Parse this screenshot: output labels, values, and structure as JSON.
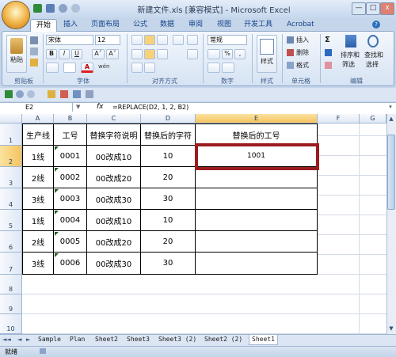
{
  "window": {
    "title": "新建文件.xls [兼容模式] - Microsoft Excel",
    "min": "—",
    "max": "□",
    "close": "x"
  },
  "tabs": [
    "开始",
    "插入",
    "页面布局",
    "公式",
    "数据",
    "审阅",
    "视图",
    "开发工具",
    "Acrobat"
  ],
  "ribbon": {
    "clipboard": {
      "label": "剪贴板",
      "paste": "粘贴"
    },
    "font": {
      "label": "字体",
      "name": "宋体",
      "size": "12",
      "bold": "B",
      "italic": "I",
      "underline": "U",
      "grow": "A˄",
      "shrink": "A˅",
      "font_color": "A",
      "wen": "wén"
    },
    "alignment": {
      "label": "对齐方式"
    },
    "number": {
      "label": "数字",
      "format": "常规",
      "percent": "%",
      "comma": ","
    },
    "styles": {
      "label": "样式",
      "text": "样式"
    },
    "cells": {
      "label": "单元格",
      "insert": "插入",
      "delete": "删除",
      "format": "格式"
    },
    "editing": {
      "label": "编辑",
      "sort": "排序和",
      "sort2": "筛选",
      "find": "查找和",
      "find2": "选择"
    }
  },
  "formula_bar": {
    "name_box": "E2",
    "fx": "fx",
    "formula": "=REPLACE(D2, 1, 2, B2)"
  },
  "columns": [
    "A",
    "B",
    "C",
    "D",
    "E",
    "F",
    "G"
  ],
  "rows": [
    "1",
    "2",
    "3",
    "4",
    "5",
    "6",
    "7",
    "8",
    "9",
    "10"
  ],
  "table": {
    "headers": [
      "生产线",
      "工号",
      "替换字符说明",
      "替换后的字符",
      "替换后的工号"
    ],
    "rows": [
      [
        "1线",
        "0001",
        "00改成10",
        "10",
        "1001"
      ],
      [
        "2线",
        "0002",
        "00改成20",
        "20",
        ""
      ],
      [
        "3线",
        "0003",
        "00改成30",
        "30",
        ""
      ],
      [
        "1线",
        "0004",
        "00改成10",
        "10",
        ""
      ],
      [
        "2线",
        "0005",
        "00改成20",
        "20",
        ""
      ],
      [
        "3线",
        "0006",
        "00改成30",
        "30",
        ""
      ]
    ]
  },
  "sheets": [
    "Sample",
    "Plan",
    "Sheet2",
    "Sheet3",
    "Sheet3 (2)",
    "Sheet2 (2)",
    "Sheet1"
  ],
  "status": {
    "ready": "就绪"
  },
  "colors": {
    "highlight": "#9b1b1f",
    "comment_marker": "#1e5a28"
  }
}
